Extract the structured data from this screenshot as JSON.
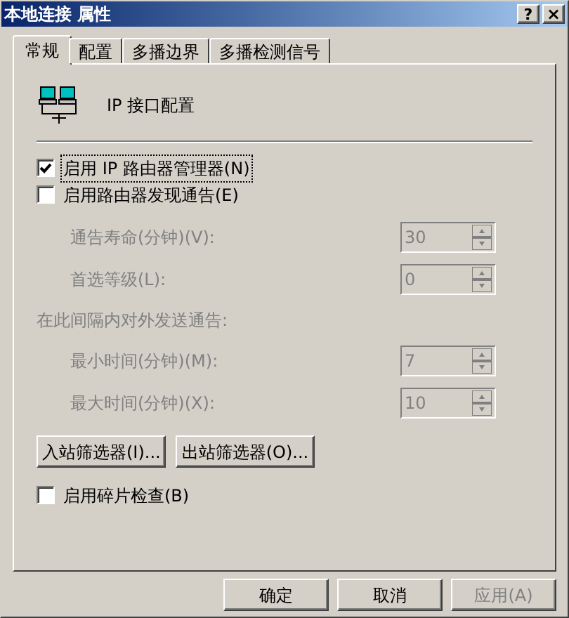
{
  "window": {
    "title": "本地连接 属性",
    "help": "?",
    "close": "×"
  },
  "tabs": [
    {
      "label": "常规",
      "selected": true
    },
    {
      "label": "配置",
      "selected": false
    },
    {
      "label": "多播边界",
      "selected": false
    },
    {
      "label": "多播检测信号",
      "selected": false
    }
  ],
  "header": {
    "label": "IP 接口配置"
  },
  "router_manager": {
    "label": "启用 IP 路由器管理器(N)",
    "checked": true
  },
  "router_discovery": {
    "label": "启用路由器发现通告(E)",
    "checked": false
  },
  "discovery_fields": [
    {
      "label": "通告寿命(分钟)(V):",
      "value": "30",
      "disabled": true
    },
    {
      "label": "首选等级(L):",
      "value": "0",
      "disabled": true
    }
  ],
  "interval_heading": {
    "label": "在此间隔内对外发送通告:",
    "disabled": true
  },
  "interval_fields": [
    {
      "label": "最小时间(分钟)(M):",
      "value": "7",
      "disabled": true
    },
    {
      "label": "最大时间(分钟)(X):",
      "value": "10",
      "disabled": true
    }
  ],
  "filter_buttons": [
    "入站筛选器(I)...",
    "出站筛选器(O)..."
  ],
  "fragment_check": {
    "label": "启用碎片检查(B)",
    "checked": false
  },
  "buttons": [
    {
      "label": "确定",
      "disabled": false
    },
    {
      "label": "取消",
      "disabled": false
    },
    {
      "label": "应用(A)",
      "disabled": true
    }
  ]
}
